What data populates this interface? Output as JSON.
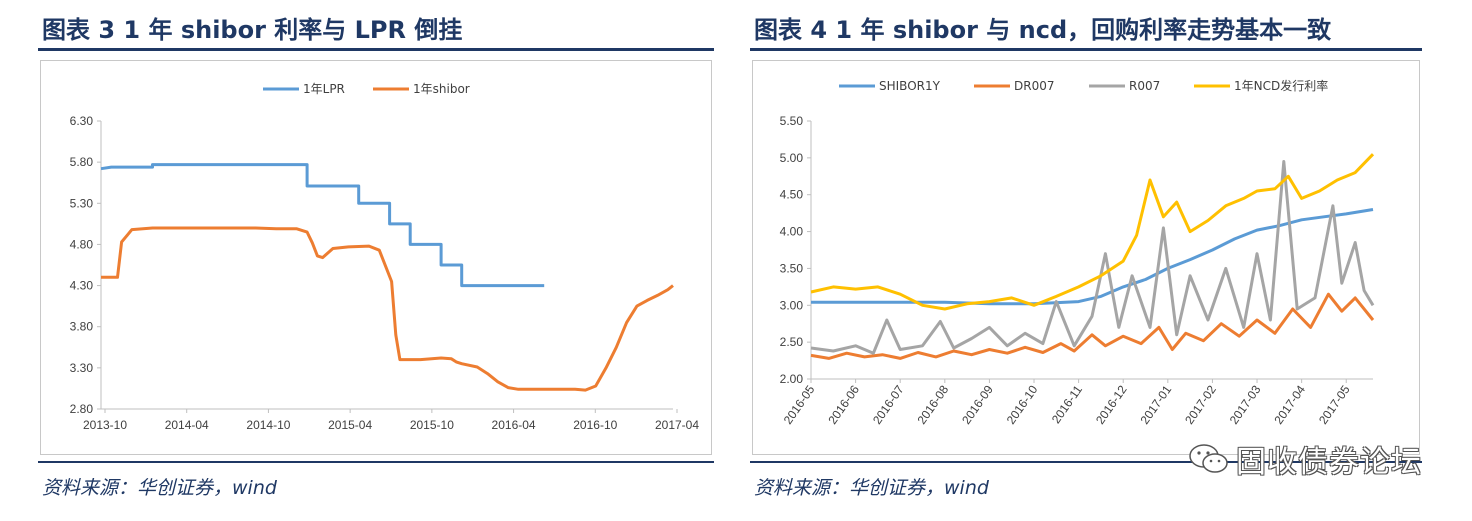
{
  "left": {
    "title": "图表 3   1 年 shibor 利率与 LPR 倒挂",
    "source": "资料来源：华创证券，wind",
    "chart_data": {
      "type": "line",
      "x_ticks": [
        "2013-10",
        "2014-04",
        "2014-10",
        "2015-04",
        "2015-10",
        "2016-04",
        "2016-10",
        "2017-04"
      ],
      "y_ticks": [
        "6.30",
        "5.80",
        "5.30",
        "4.80",
        "4.30",
        "3.80",
        "3.30",
        "2.80"
      ],
      "ylim": [
        2.8,
        6.3
      ],
      "xlim": [
        0,
        43
      ],
      "series": [
        {
          "name": "1年LPR",
          "color": "#5b9bd5",
          "points": [
            [
              0,
              5.72
            ],
            [
              1,
              5.74
            ],
            [
              5,
              5.74
            ],
            [
              5,
              5.77
            ],
            [
              20,
              5.77
            ],
            [
              20,
              5.51
            ],
            [
              25,
              5.51
            ],
            [
              25,
              5.3
            ],
            [
              28,
              5.3
            ],
            [
              28,
              5.05
            ],
            [
              30,
              5.05
            ],
            [
              30,
              4.8
            ],
            [
              33,
              4.8
            ],
            [
              33,
              4.55
            ],
            [
              35,
              4.55
            ],
            [
              35,
              4.3
            ],
            [
              43,
              4.3
            ]
          ]
        },
        {
          "name": "1年shibor",
          "color": "#ed7d31",
          "points": [
            [
              0,
              4.4
            ],
            [
              1.6,
              4.4
            ],
            [
              2,
              4.83
            ],
            [
              3,
              4.98
            ],
            [
              5,
              5.0
            ],
            [
              10,
              5.0
            ],
            [
              15,
              5.0
            ],
            [
              17,
              4.99
            ],
            [
              19,
              4.99
            ],
            [
              20,
              4.95
            ],
            [
              20.5,
              4.82
            ],
            [
              21,
              4.66
            ],
            [
              21.5,
              4.64
            ],
            [
              22.5,
              4.75
            ],
            [
              24,
              4.77
            ],
            [
              26,
              4.78
            ],
            [
              27,
              4.73
            ],
            [
              28.2,
              4.35
            ],
            [
              28.6,
              3.7
            ],
            [
              29,
              3.4
            ],
            [
              31,
              3.4
            ],
            [
              33,
              3.42
            ],
            [
              34,
              3.41
            ],
            [
              34.5,
              3.37
            ],
            [
              35,
              3.35
            ],
            [
              36.5,
              3.31
            ],
            [
              37.5,
              3.23
            ],
            [
              38.5,
              3.13
            ],
            [
              39.5,
              3.06
            ],
            [
              40.5,
              3.04
            ],
            [
              42,
              3.04
            ],
            [
              44,
              3.04
            ],
            [
              46,
              3.04
            ],
            [
              47,
              3.03
            ],
            [
              48,
              3.08
            ],
            [
              49,
              3.3
            ],
            [
              50,
              3.55
            ],
            [
              51,
              3.85
            ],
            [
              52,
              4.05
            ],
            [
              53,
              4.12
            ],
            [
              54,
              4.18
            ],
            [
              55,
              4.25
            ],
            [
              55.5,
              4.3
            ]
          ]
        }
      ]
    }
  },
  "right": {
    "title": "图表 4   1 年 shibor 与 ncd，回购利率走势基本一致",
    "source": "资料来源：华创证券，wind",
    "watermark": "固收债券论坛",
    "chart_data": {
      "type": "line",
      "x_ticks": [
        "2016-05",
        "2016-06",
        "2016-07",
        "2016-08",
        "2016-09",
        "2016-10",
        "2016-11",
        "2016-12",
        "2017-01",
        "2017-02",
        "2017-03",
        "2017-04",
        "2017-05"
      ],
      "y_ticks": [
        "5.50",
        "5.00",
        "4.50",
        "4.00",
        "3.50",
        "3.00",
        "2.50",
        "2.00"
      ],
      "ylim": [
        2.0,
        5.5
      ],
      "xlim": [
        0,
        12.6
      ],
      "series": [
        {
          "name": "SHIBOR1Y",
          "color": "#5b9bd5",
          "points": [
            [
              0,
              3.04
            ],
            [
              3,
              3.04
            ],
            [
              4,
              3.02
            ],
            [
              5,
              3.02
            ],
            [
              6,
              3.05
            ],
            [
              6.5,
              3.12
            ],
            [
              7,
              3.25
            ],
            [
              7.5,
              3.35
            ],
            [
              8,
              3.5
            ],
            [
              8.5,
              3.62
            ],
            [
              9,
              3.75
            ],
            [
              9.5,
              3.9
            ],
            [
              10,
              4.02
            ],
            [
              10.5,
              4.08
            ],
            [
              11,
              4.16
            ],
            [
              11.5,
              4.2
            ],
            [
              12,
              4.24
            ],
            [
              12.6,
              4.3
            ]
          ]
        },
        {
          "name": "DR007",
          "color": "#ed7d31",
          "points": [
            [
              0,
              2.32
            ],
            [
              0.4,
              2.28
            ],
            [
              0.8,
              2.35
            ],
            [
              1.2,
              2.3
            ],
            [
              1.6,
              2.33
            ],
            [
              2,
              2.28
            ],
            [
              2.4,
              2.36
            ],
            [
              2.8,
              2.3
            ],
            [
              3.2,
              2.38
            ],
            [
              3.6,
              2.33
            ],
            [
              4,
              2.4
            ],
            [
              4.4,
              2.35
            ],
            [
              4.8,
              2.43
            ],
            [
              5.2,
              2.36
            ],
            [
              5.6,
              2.48
            ],
            [
              5.9,
              2.38
            ],
            [
              6.3,
              2.6
            ],
            [
              6.6,
              2.45
            ],
            [
              7,
              2.58
            ],
            [
              7.4,
              2.48
            ],
            [
              7.8,
              2.7
            ],
            [
              8.1,
              2.4
            ],
            [
              8.4,
              2.62
            ],
            [
              8.8,
              2.52
            ],
            [
              9.2,
              2.75
            ],
            [
              9.6,
              2.58
            ],
            [
              10,
              2.8
            ],
            [
              10.4,
              2.62
            ],
            [
              10.8,
              2.95
            ],
            [
              11.2,
              2.7
            ],
            [
              11.6,
              3.15
            ],
            [
              11.9,
              2.92
            ],
            [
              12.2,
              3.1
            ],
            [
              12.6,
              2.8
            ]
          ]
        },
        {
          "name": "R007",
          "color": "#a5a5a5",
          "points": [
            [
              0,
              2.42
            ],
            [
              0.5,
              2.38
            ],
            [
              1,
              2.45
            ],
            [
              1.4,
              2.35
            ],
            [
              1.7,
              2.8
            ],
            [
              2,
              2.4
            ],
            [
              2.5,
              2.45
            ],
            [
              2.9,
              2.78
            ],
            [
              3.2,
              2.42
            ],
            [
              3.6,
              2.55
            ],
            [
              4,
              2.7
            ],
            [
              4.4,
              2.45
            ],
            [
              4.8,
              2.62
            ],
            [
              5.2,
              2.48
            ],
            [
              5.5,
              3.05
            ],
            [
              5.9,
              2.45
            ],
            [
              6.3,
              2.85
            ],
            [
              6.6,
              3.7
            ],
            [
              6.9,
              2.7
            ],
            [
              7.2,
              3.4
            ],
            [
              7.6,
              2.7
            ],
            [
              7.9,
              4.05
            ],
            [
              8.2,
              2.6
            ],
            [
              8.5,
              3.4
            ],
            [
              8.9,
              2.8
            ],
            [
              9.3,
              3.5
            ],
            [
              9.7,
              2.7
            ],
            [
              10,
              3.7
            ],
            [
              10.3,
              2.8
            ],
            [
              10.6,
              4.95
            ],
            [
              10.9,
              2.95
            ],
            [
              11.3,
              3.1
            ],
            [
              11.7,
              4.35
            ],
            [
              11.9,
              3.3
            ],
            [
              12.2,
              3.85
            ],
            [
              12.4,
              3.2
            ],
            [
              12.6,
              3.0
            ]
          ]
        },
        {
          "name": "1年NCD发行利率",
          "color": "#ffc000",
          "points": [
            [
              0,
              3.18
            ],
            [
              0.5,
              3.25
            ],
            [
              1,
              3.22
            ],
            [
              1.5,
              3.25
            ],
            [
              2,
              3.15
            ],
            [
              2.5,
              3.0
            ],
            [
              3,
              2.95
            ],
            [
              3.5,
              3.02
            ],
            [
              4,
              3.05
            ],
            [
              4.5,
              3.1
            ],
            [
              5,
              3.0
            ],
            [
              5.5,
              3.12
            ],
            [
              6,
              3.25
            ],
            [
              6.5,
              3.4
            ],
            [
              7,
              3.6
            ],
            [
              7.3,
              3.95
            ],
            [
              7.6,
              4.7
            ],
            [
              7.9,
              4.2
            ],
            [
              8.2,
              4.4
            ],
            [
              8.5,
              4.0
            ],
            [
              8.9,
              4.15
            ],
            [
              9.3,
              4.35
            ],
            [
              9.7,
              4.45
            ],
            [
              10,
              4.55
            ],
            [
              10.4,
              4.58
            ],
            [
              10.7,
              4.75
            ],
            [
              11,
              4.45
            ],
            [
              11.4,
              4.55
            ],
            [
              11.8,
              4.7
            ],
            [
              12.2,
              4.8
            ],
            [
              12.6,
              5.05
            ]
          ]
        }
      ]
    }
  }
}
